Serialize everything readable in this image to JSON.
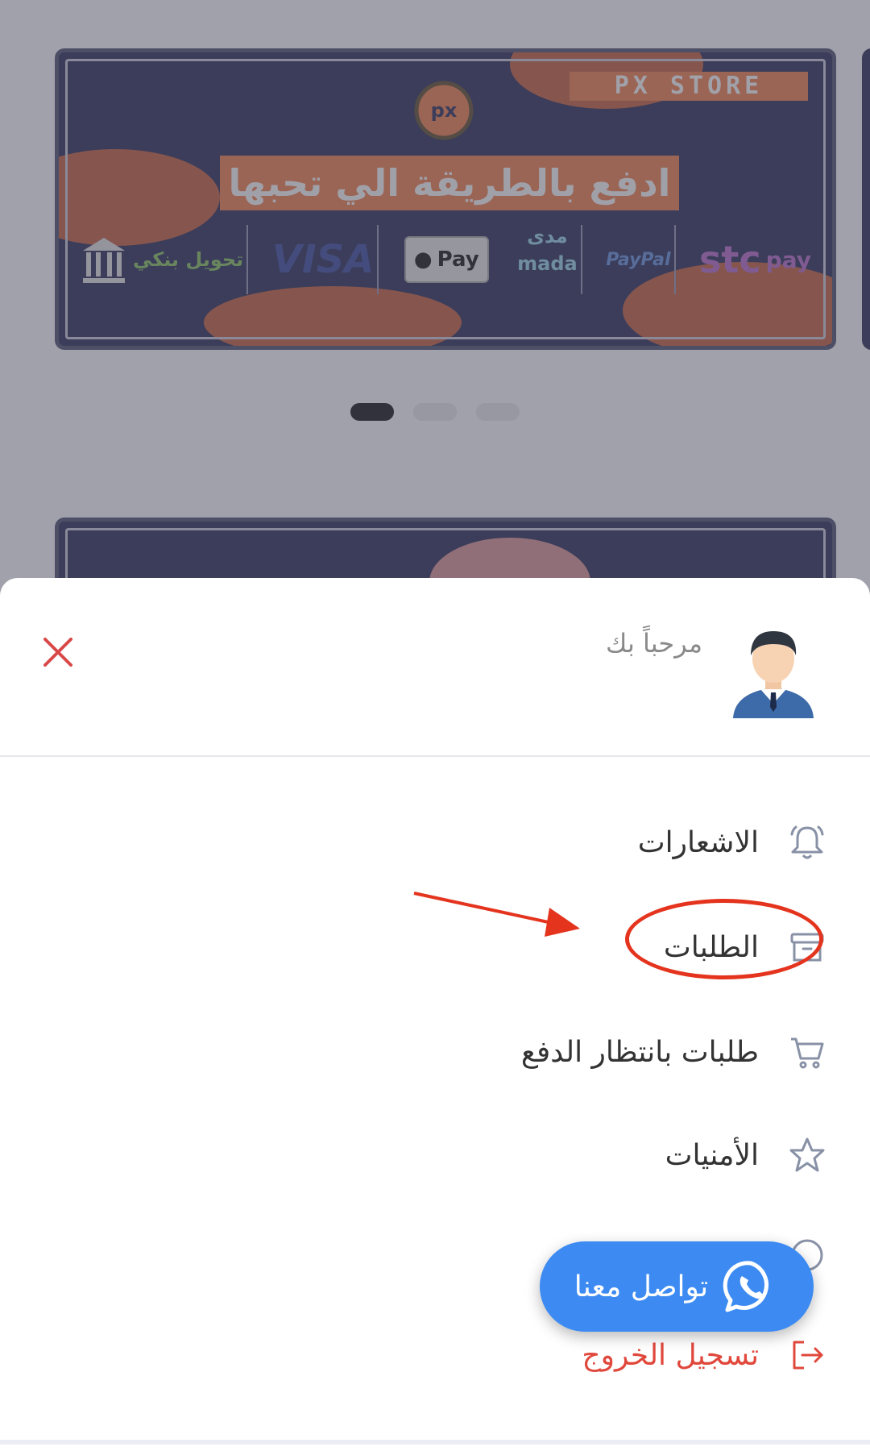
{
  "banner": {
    "store_name": "PX STORE",
    "logo_text": "px",
    "headline": "ادفع بالطريقة الي تحبها",
    "payment_methods": {
      "bank": "تحويل بنكي",
      "visa": "VISA",
      "applepay": "Pay",
      "mada_ar": "مدى",
      "mada_en": "mada",
      "paypal": "PayPal",
      "stc": "stc",
      "stc_pay": "pay"
    }
  },
  "carousel": {
    "count": 3,
    "active_index": 0
  },
  "sheet": {
    "welcome": "مرحباً بك",
    "menu": [
      {
        "label": "الاشعارات",
        "icon": "bell-icon"
      },
      {
        "label": "الطلبات",
        "icon": "archive-box-icon"
      },
      {
        "label": "طلبات بانتظار الدفع",
        "icon": "cart-icon"
      },
      {
        "label": "الأمنيات",
        "icon": "star-icon"
      },
      {
        "label": "",
        "icon": "help-icon"
      },
      {
        "label": "تسجيل الخروج",
        "icon": "logout-icon"
      }
    ]
  },
  "fab": {
    "label": "تواصل معنا",
    "icon": "whatsapp-icon"
  },
  "colors": {
    "accent_blue": "#3d8bf2",
    "logout_red": "#e0483c",
    "annotation_red": "#e4341e",
    "close_red": "#d94848"
  }
}
